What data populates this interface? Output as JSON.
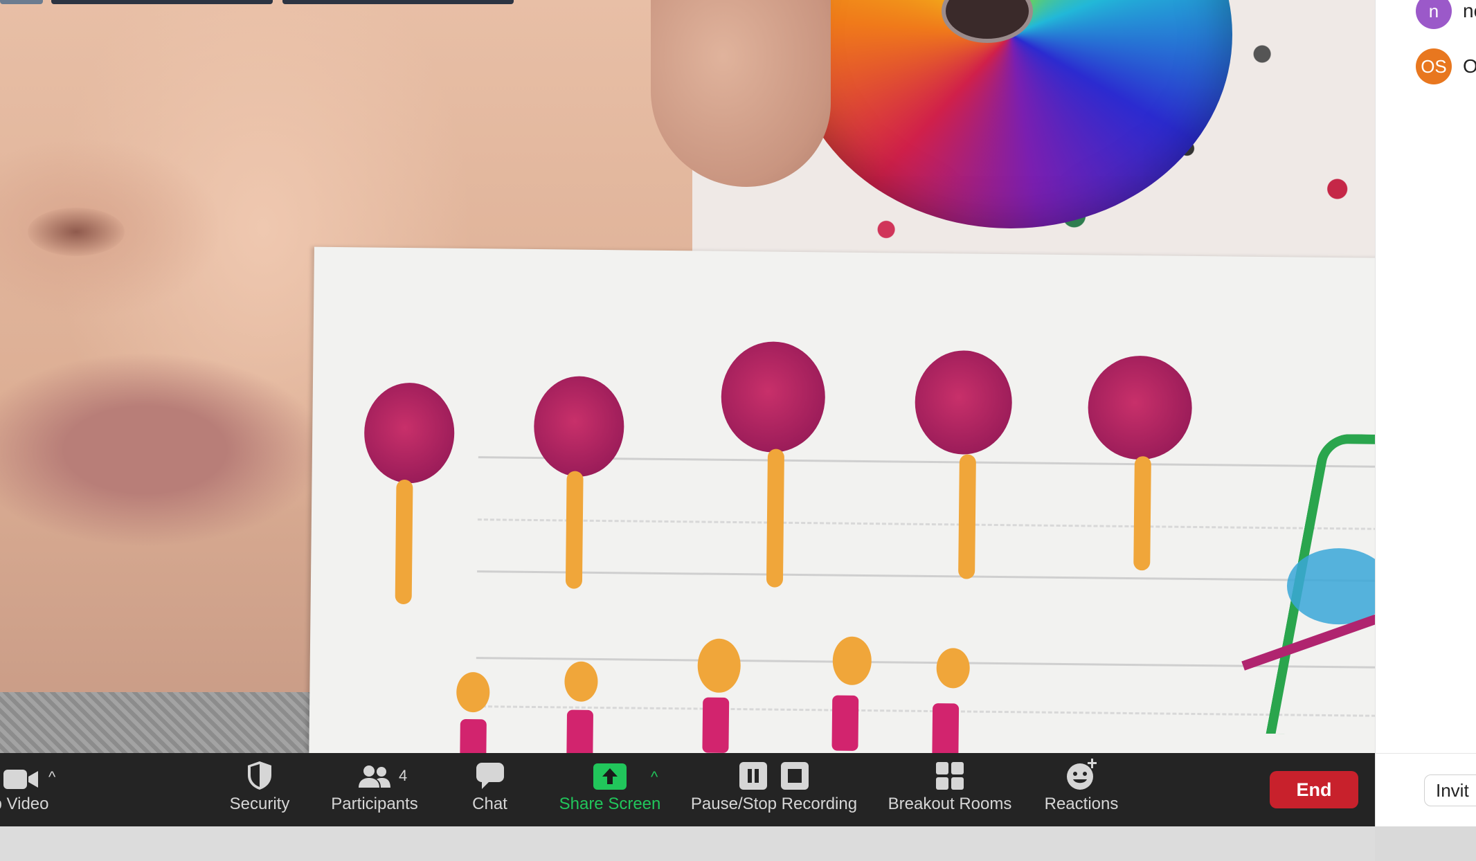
{
  "participants_panel": {
    "items": [
      {
        "initials": "n",
        "name": "nc",
        "color": "#9b59c9"
      },
      {
        "initials": "OS",
        "name": "O",
        "color": "#e8771f"
      }
    ],
    "invite_label": "Invit"
  },
  "toolbar": {
    "video_label": "p Video",
    "security_label": "Security",
    "participants_label": "Participants",
    "participants_count": "4",
    "chat_label": "Chat",
    "share_label": "Share Screen",
    "recording_label": "Pause/Stop Recording",
    "breakout_label": "Breakout Rooms",
    "reactions_label": "Reactions",
    "end_label": "End",
    "caret": "^"
  },
  "colors": {
    "toolbar_bg": "#242424",
    "share_green": "#21c65b",
    "end_red": "#c8212c"
  }
}
